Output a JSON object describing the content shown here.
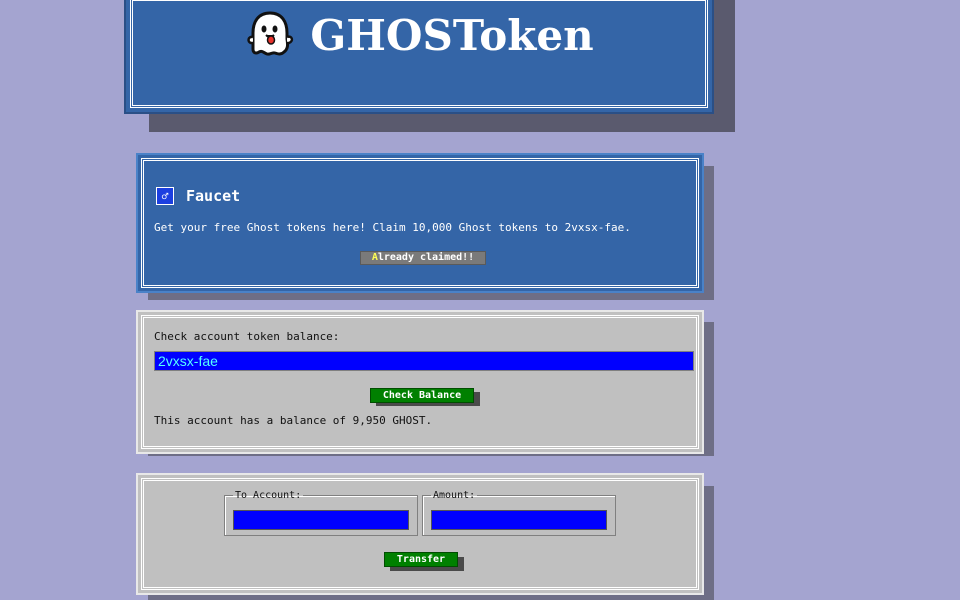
{
  "header": {
    "logo_icon": "ghost-icon",
    "title": "GHOSToken"
  },
  "faucet": {
    "icon": "faucet-icon",
    "title": "Faucet",
    "description": "Get your free Ghost tokens here! Claim 10,000 Ghost tokens to 2vxsx-fae.",
    "button_first_letter": "A",
    "button_rest": "lready claimed!!"
  },
  "balance": {
    "label": "Check account token balance:",
    "input_value": "2vxsx-fae",
    "button_label": "Check Balance",
    "result": "This account has a balance of 9,950 GHOST."
  },
  "transfer": {
    "to_account_label": "To Account:",
    "to_account_value": "",
    "amount_label": "Amount:",
    "amount_value": "",
    "button_label": "Transfer"
  },
  "colors": {
    "background": "#a4a4d0",
    "panel_blue": "#3465a7",
    "panel_grey": "#c0c0c0",
    "input_blue": "#0000ff",
    "button_green": "#008000"
  }
}
